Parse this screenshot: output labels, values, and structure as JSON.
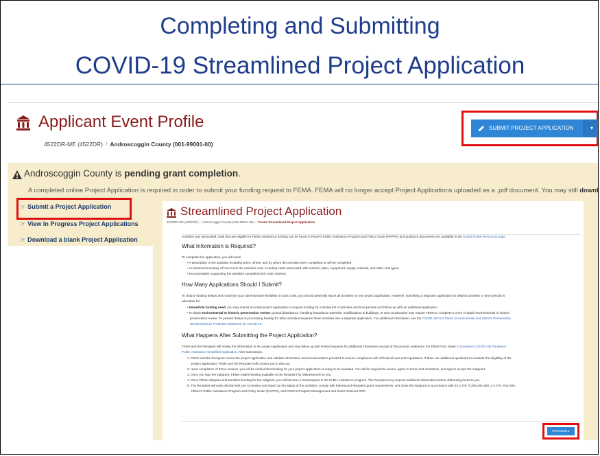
{
  "slide": {
    "title_line1": "Completing and Submitting",
    "title_line2": "COVID-19 Streamlined Project Application"
  },
  "event": {
    "title": "Applicant Event Profile",
    "event_id": "4522DR-ME (4522DR)",
    "applicant": "Androscoggin County (001-99001-00)"
  },
  "actions": {
    "submit_label": "SUBMIT PROJECT APPLICATION",
    "caret": "▾"
  },
  "banner": {
    "county": "Androscoggin County is ",
    "status": "pending grant completion",
    "period": ".",
    "text_before": "A completed online Project Application is required in order to submit your funding request to FEMA. FEMA will no longer accept Project Applications uploaded as a .pdf document. You may still ",
    "text_bold": "download a blank Proje"
  },
  "sidebar": {
    "items": [
      {
        "label": "Submit a Project Application"
      },
      {
        "label": "View In Progress Project Applications"
      },
      {
        "label": "Download a blank Project Application"
      }
    ]
  },
  "streamlined": {
    "title": "Streamlined Project Application",
    "crumb1": "4522DR-ME (4522DR)",
    "crumb2": "Androscoggin County (001-99001-00)",
    "crumb3": "Create Streamlined Project Application",
    "intro": "Activities and associated costs that are eligible for Public Assistance funding can be found in FEMA's Public Assistance Program and Policy Guide (PAPPG) and guidance documents are available in the ",
    "intro_link": "Grants Portal Resources page.",
    "h1": "What Information is Required?",
    "p1": "To complete this application, you will need:",
    "b1": "• A description of the activities including when, where, and by whom the activities were completed or will be completed.",
    "b2": "• An itemized summary of how much the activities cost, including costs associated with contract, labor, equipment, supply, material, and other cost types.",
    "b3": "• Documentation supporting the activities completed and costs claimed.",
    "h2": "How Many Applications Should I Submit?",
    "p2a": "To reduce funding delays and maximize your administrative flexibility to track costs, you should generally report all activities on one project application. However, submitting a separate application for distinct activities or time periods is",
    "p2b": "advisable for:",
    "c1_bold": "Immediate funding need",
    "c1": ": you may submit an initial project application to request funding for a limited list of activities and time periods and follow-up with an additional application.",
    "c2_pre": "In-depth ",
    "c2_bold": "environmental or historic preservation review",
    "c2": ": ground disturbance, handling hazardous materials, modifications to buildings, or new construction may require FEMA to complete a more in-depth environmental or historic",
    "c2b": "preservation review. To prevent delays in processing funding for other activities separate these activities into a separate application. For additional information, see the ",
    "c2b_link": "COVID-19 Fact Sheet: Environmental and Historic Preservation",
    "c2c_link": "and Emergency Protective Measures for COVID-19.",
    "h3": "What Happens After Submitting the Project Application?",
    "p3a": "FEMA and the Recipient will review the information in the project application and may follow up with limited requests for additional information as part of the process outlined in the FEMA Fact Sheet ",
    "p3a_link": "Coronavirus (COVID-19) Pandemic:",
    "p3b_link": "Public Assistance Simplified Application",
    "p3b": ". After submission:",
    "n1": "1. FEMA and the Recipient review the project application and validate information and documentation provided to ensure compliance with all federal laws and regulations. If there are additional questions to evaluate the eligibility of the",
    "n1b": "project application, FEMA and the Recipient will contact you to discuss.",
    "n2": "2. Upon completion of these reviews, you will be notified that funding for your project application is ready to be awarded. You will be required to review, agree to terms and conditions, and sign to accept the subgrant.",
    "n3": "3. Once you sign the subgrant, FEMA makes funding available to the Recipient for disbursement to you.",
    "n4": "4. Once FEMA obligates and transfers funding for the subgrant, you will become a Subrecipient in the Public Assistance program. The Recipient may request additional information before disbursing funds to you.",
    "n5": "5. The Recipient will work directly with you to monitor and report on the status of the activities, comply with federal and Recipient grant requirements, and close the subgrant in accordance with 44 C.F.R. § 206.204-209, 2 C.F.R. Part 200,",
    "n5b": "FEMA's Public Assistance Program and Policy Guide (PAPPG), and FEMA's Program Management and Grant Closeout SOP.",
    "proceed": "PROCEED ▸"
  },
  "colors": {
    "title_blue": "#1f3d8a",
    "header_red": "#8a1c1c",
    "button_blue": "#2f86d6",
    "banner_bg": "#f7eccc",
    "highlight_red": "#e01010"
  }
}
